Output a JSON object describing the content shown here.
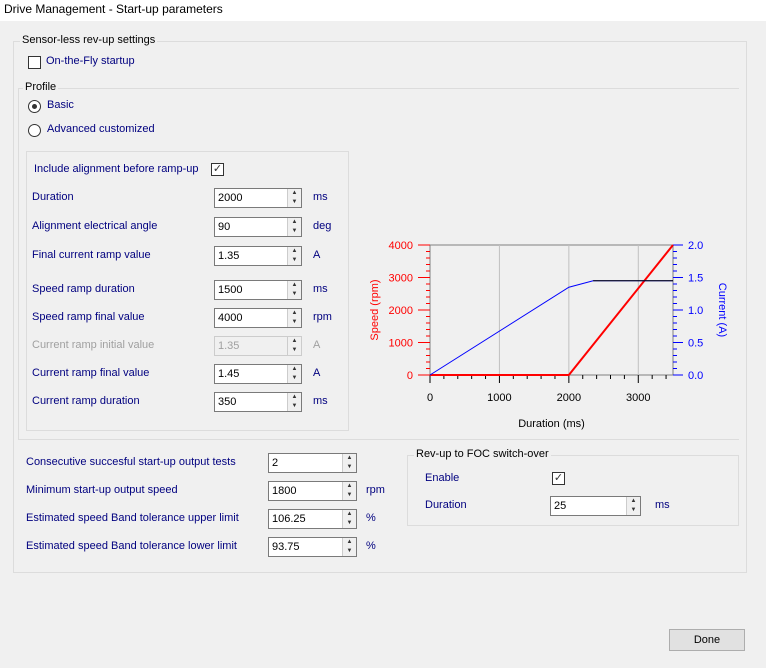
{
  "window": {
    "title": "Drive Management - Start-up parameters"
  },
  "sensorless": {
    "group_label": "Sensor-less rev-up settings",
    "on_the_fly": {
      "label": "On-the-Fly startup",
      "checked": false
    }
  },
  "profile": {
    "group_label": "Profile",
    "basic": {
      "label": "Basic",
      "selected": true
    },
    "advanced": {
      "label": "Advanced customized",
      "selected": false
    }
  },
  "alignment": {
    "label": "Include alignment before ramp-up",
    "checked": true,
    "check_glyph": "✓"
  },
  "params": [
    {
      "label": "Duration",
      "value": "2000",
      "unit": "ms",
      "enabled": true
    },
    {
      "label": "Alignment electrical angle",
      "value": "90",
      "unit": "deg",
      "enabled": true
    },
    {
      "label": "Final current ramp value",
      "value": "1.35",
      "unit": "A",
      "enabled": true
    },
    {
      "label": "Speed ramp duration",
      "value": "1500",
      "unit": "ms",
      "enabled": true
    },
    {
      "label": "Speed ramp final value",
      "value": "4000",
      "unit": "rpm",
      "enabled": true
    },
    {
      "label": "Current ramp initial value",
      "value": "1.35",
      "unit": "A",
      "enabled": false
    },
    {
      "label": "Current ramp final value",
      "value": "1.45",
      "unit": "A",
      "enabled": true
    },
    {
      "label": "Current ramp duration",
      "value": "350",
      "unit": "ms",
      "enabled": true
    }
  ],
  "bottom": [
    {
      "label": "Consecutive succesful start-up output tests",
      "value": "2",
      "unit": ""
    },
    {
      "label": "Minimum start-up output speed",
      "value": "1800",
      "unit": "rpm"
    },
    {
      "label": "Estimated speed Band tolerance upper limit",
      "value": "106.25",
      "unit": "%"
    },
    {
      "label": "Estimated speed Band tolerance lower limit",
      "value": "93.75",
      "unit": "%"
    }
  ],
  "switchover": {
    "group_label": "Rev-up to FOC switch-over",
    "enable_label": "Enable",
    "enable_checked": true,
    "duration_label": "Duration",
    "duration_value": "25",
    "duration_unit": "ms"
  },
  "done_label": "Done",
  "arrow_up": "▲",
  "arrow_down": "▼",
  "chart_data": {
    "type": "line",
    "xlabel": "Duration (ms)",
    "ylabel": "Speed (rpm)",
    "y2label": "Current (A)",
    "xlim": [
      0,
      3500
    ],
    "ylim": [
      0,
      4000
    ],
    "y2lim": [
      0,
      2
    ],
    "xticks": [
      "0",
      "1000",
      "2000",
      "3000"
    ],
    "yticks": [
      "0",
      "1000",
      "2000",
      "3000",
      "4000"
    ],
    "y2ticks": [
      "0.0",
      "0.5",
      "1.0",
      "1.5",
      "2.0"
    ],
    "series": [
      {
        "name": "Speed",
        "axis": "left",
        "color": "#ff0000",
        "x": [
          0,
          2000,
          3500
        ],
        "y": [
          0,
          0,
          4000
        ]
      },
      {
        "name": "Current",
        "axis": "right",
        "color": "#0000ff",
        "x": [
          0,
          2000,
          2350,
          3500
        ],
        "y": [
          0,
          1.35,
          1.45,
          1.45
        ]
      }
    ]
  }
}
